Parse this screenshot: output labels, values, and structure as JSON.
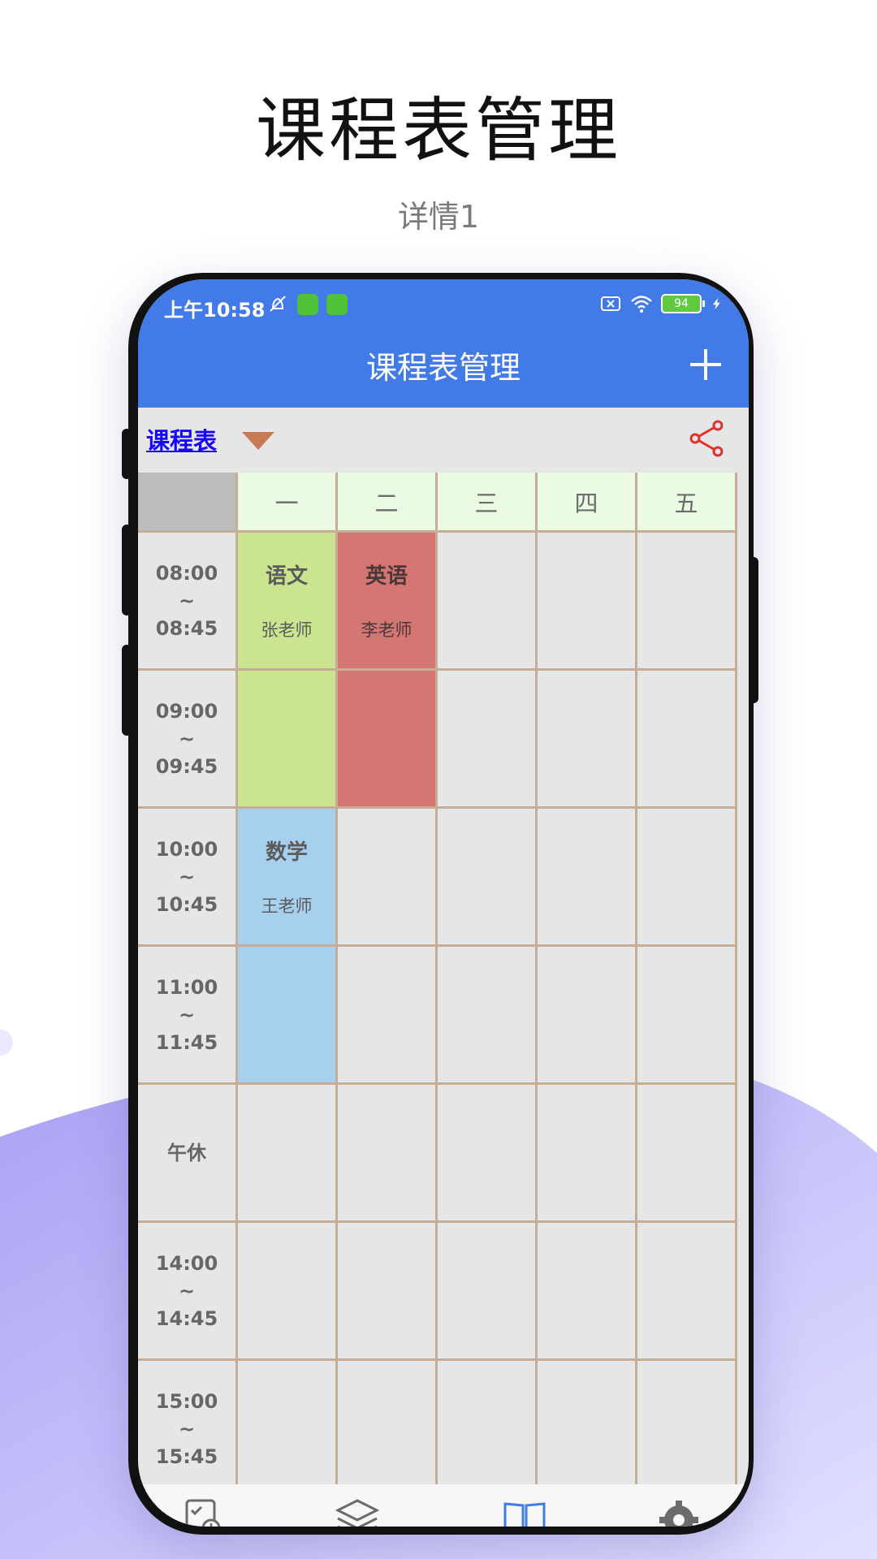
{
  "promo": {
    "title": "课程表管理",
    "subtitle": "详情1"
  },
  "status_bar": {
    "time": "上午10:58",
    "battery": "94",
    "icons": [
      "mute-icon",
      "app-badge-icon",
      "app-badge-icon",
      "sim-off-icon",
      "wifi-icon",
      "battery-icon",
      "charging-icon"
    ]
  },
  "app_bar": {
    "title": "课程表管理",
    "add_icon": "plus-icon"
  },
  "toolbar": {
    "timetable_label": "课程表",
    "dropdown_icon": "caret-down-icon",
    "share_icon": "share-icon"
  },
  "timetable": {
    "days": [
      "一",
      "二",
      "三",
      "四",
      "五"
    ],
    "slots": [
      {
        "time_start": "08:00",
        "sep": "~",
        "time_end": "08:45"
      },
      {
        "time_start": "09:00",
        "sep": "~",
        "time_end": "09:45"
      },
      {
        "time_start": "10:00",
        "sep": "~",
        "time_end": "10:45"
      },
      {
        "time_start": "11:00",
        "sep": "~",
        "time_end": "11:45"
      },
      {
        "label": "午休"
      },
      {
        "time_start": "14:00",
        "sep": "~",
        "time_end": "14:45"
      },
      {
        "time_start": "15:00",
        "sep": "~",
        "time_end": "15:45"
      }
    ],
    "courses": [
      {
        "name": "语文",
        "teacher": "张老师",
        "color": "#cbe48f"
      },
      {
        "name": "英语",
        "teacher": "李老师",
        "color": "#d47674"
      },
      {
        "name": "数学",
        "teacher": "王老师",
        "color": "#a7cfee"
      }
    ]
  },
  "bottom_nav": {
    "items": [
      "schedule-icon",
      "layers-icon",
      "book-icon",
      "settings-icon"
    ],
    "active_index": 2,
    "active_color": "#427be8"
  },
  "colors": {
    "primary": "#427be8",
    "share": "#e0302c",
    "link": "#1600ff"
  }
}
